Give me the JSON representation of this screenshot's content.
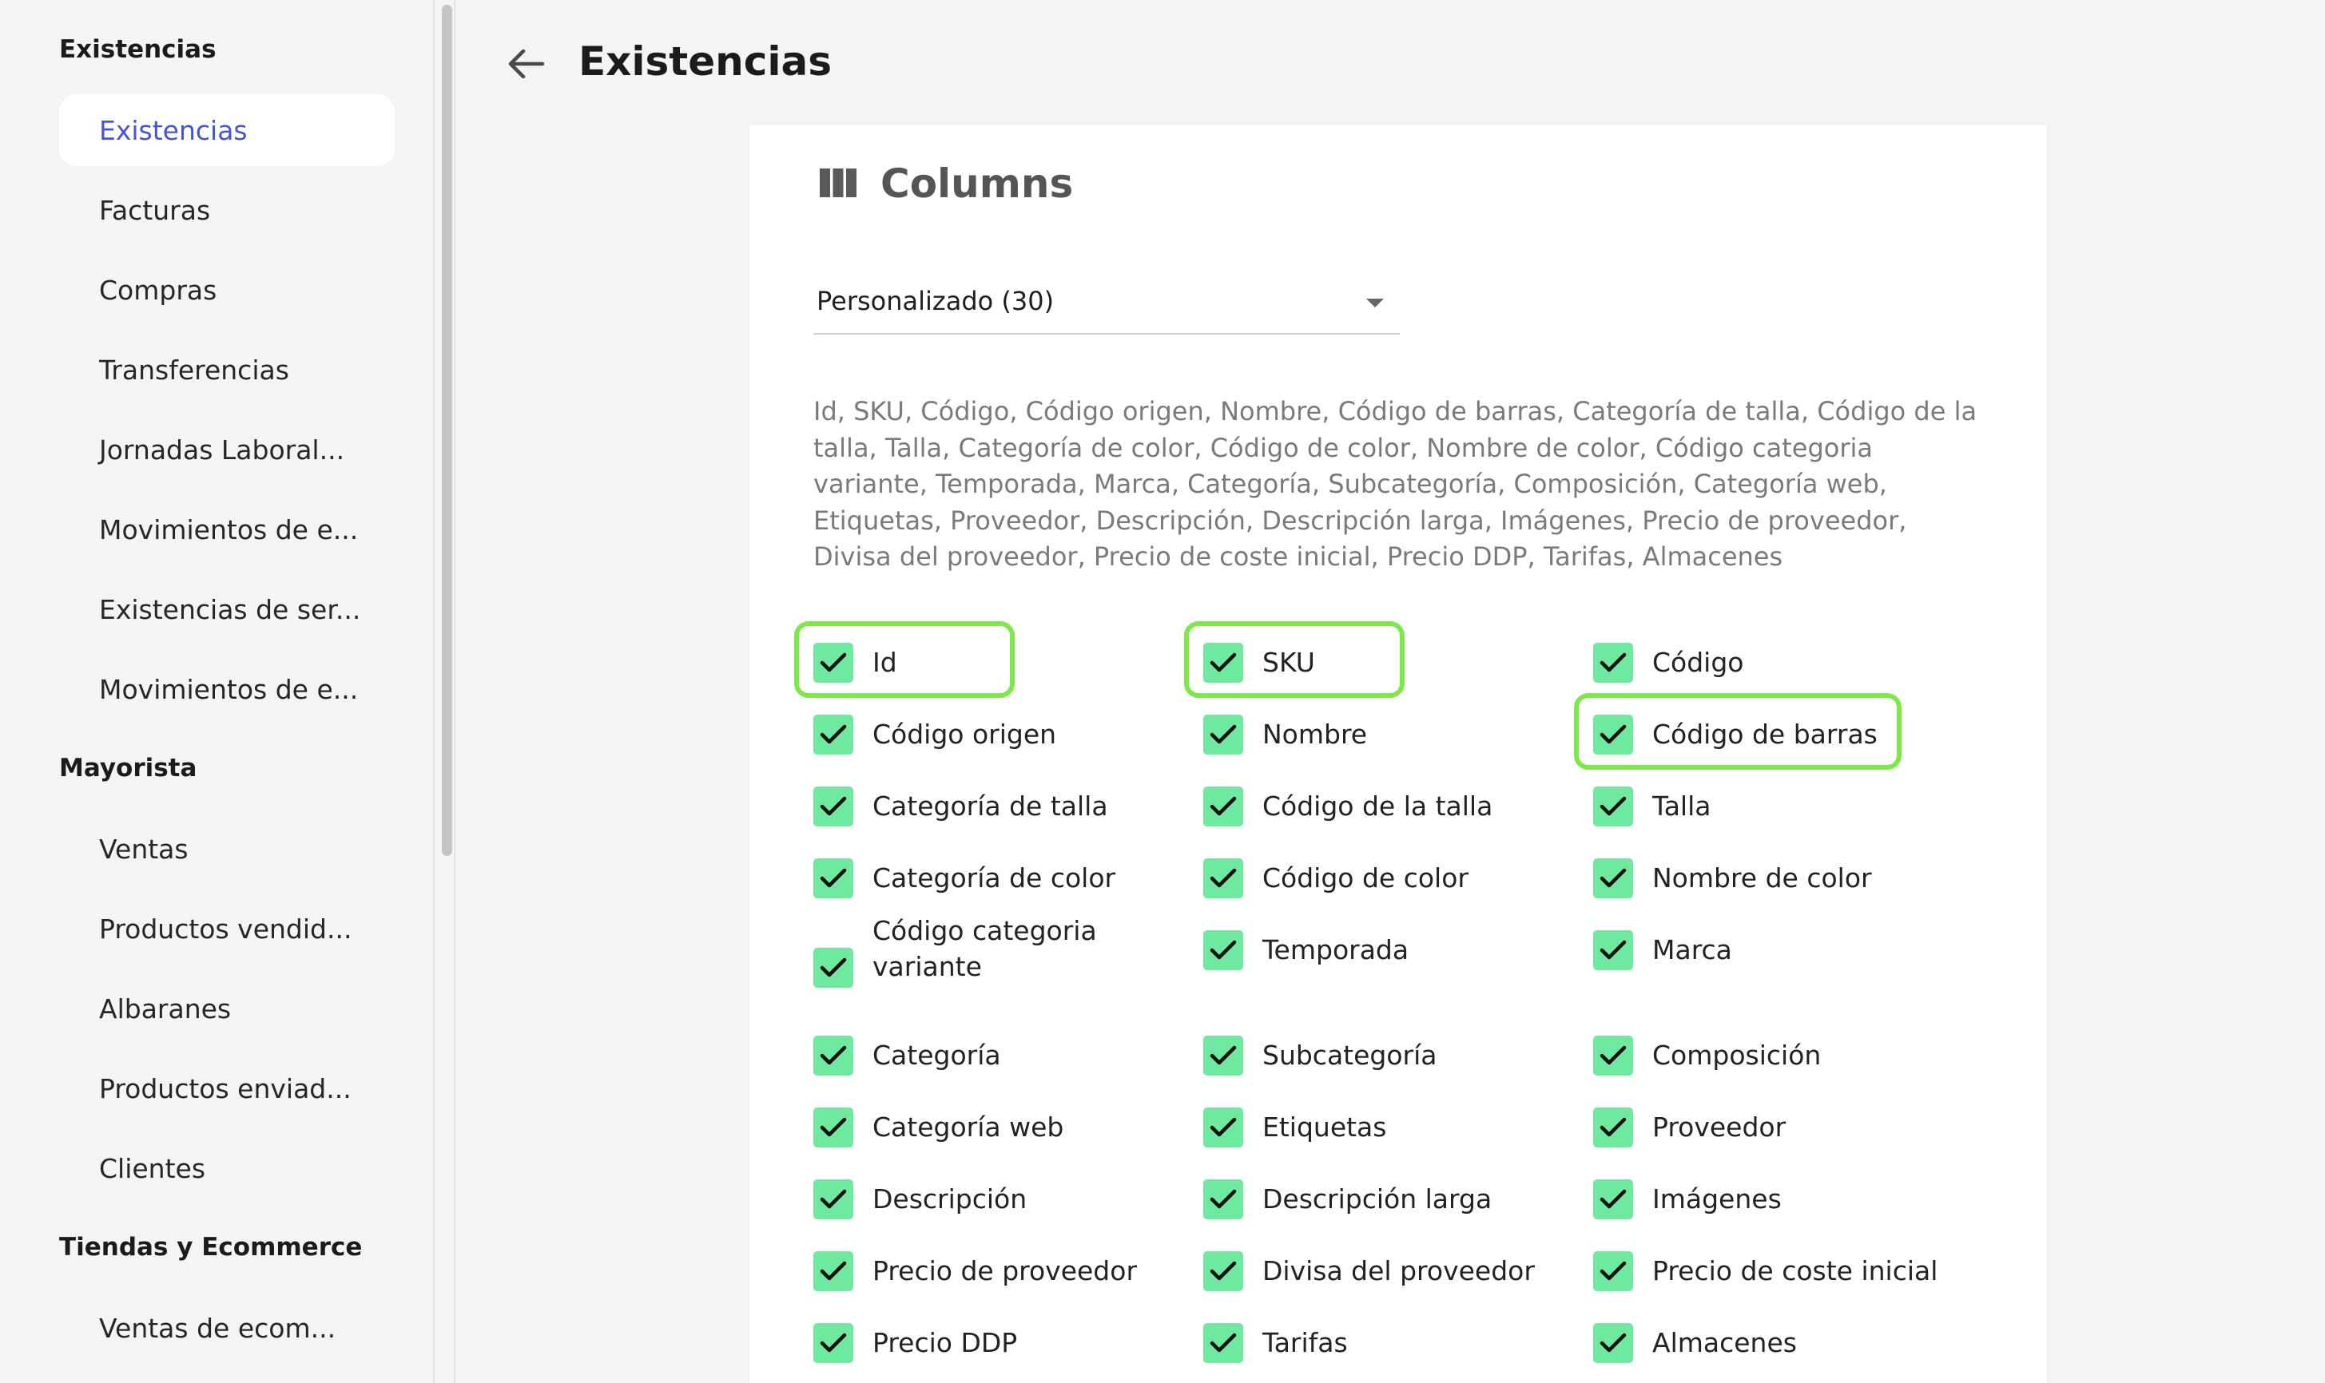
{
  "sidebar": {
    "sections": [
      {
        "title": "Existencias",
        "items": [
          "Existencias",
          "Facturas",
          "Compras",
          "Transferencias",
          "Jornadas Laboral...",
          "Movimientos de e...",
          "Existencias de ser...",
          "Movimientos de e..."
        ]
      },
      {
        "title": "Mayorista",
        "items": [
          "Ventas",
          "Productos vendid...",
          "Albaranes",
          "Productos enviad...",
          "Clientes"
        ]
      },
      {
        "title": "Tiendas y Ecommerce",
        "items": [
          "Ventas de ecom..."
        ]
      }
    ],
    "active_item": "Existencias"
  },
  "header": {
    "title": "Existencias"
  },
  "panel": {
    "title": "Columns",
    "select_value": "Personalizado (30)",
    "summary": "Id, SKU, Código, Código origen, Nombre, Código de barras, Categoría de talla, Código de la talla, Talla, Categoría de color, Código de color, Nombre de color, Código categoria variante, Temporada, Marca, Categoría, Subcategoría, Composición, Categoría web, Etiquetas, Proveedor, Descripción, Descripción larga, Imágenes, Precio de proveedor, Divisa del proveedor, Precio de coste inicial, Precio DDP, Tarifas, Almacenes",
    "columns": [
      [
        "Id",
        "Código origen",
        "Categoría de talla",
        "Categoría de color",
        "Código categoria variante",
        "Categoría",
        "Categoría web",
        "Descripción",
        "Precio de proveedor",
        "Precio DDP"
      ],
      [
        "SKU",
        "Nombre",
        "Código de la talla",
        "Código de color",
        "Temporada",
        "Subcategoría",
        "Etiquetas",
        "Descripción larga",
        "Divisa del proveedor",
        "Tarifas"
      ],
      [
        "Código",
        "Código de barras",
        "Talla",
        "Nombre de color",
        "Marca",
        "Composición",
        "Proveedor",
        "Imágenes",
        "Precio de coste inicial",
        "Almacenes"
      ]
    ],
    "highlighted": [
      "Id",
      "SKU",
      "Código de barras"
    ]
  },
  "colors": {
    "accent": "#4554d8",
    "checkbox": "#6fe8a0",
    "highlight": "#7ee84a"
  }
}
